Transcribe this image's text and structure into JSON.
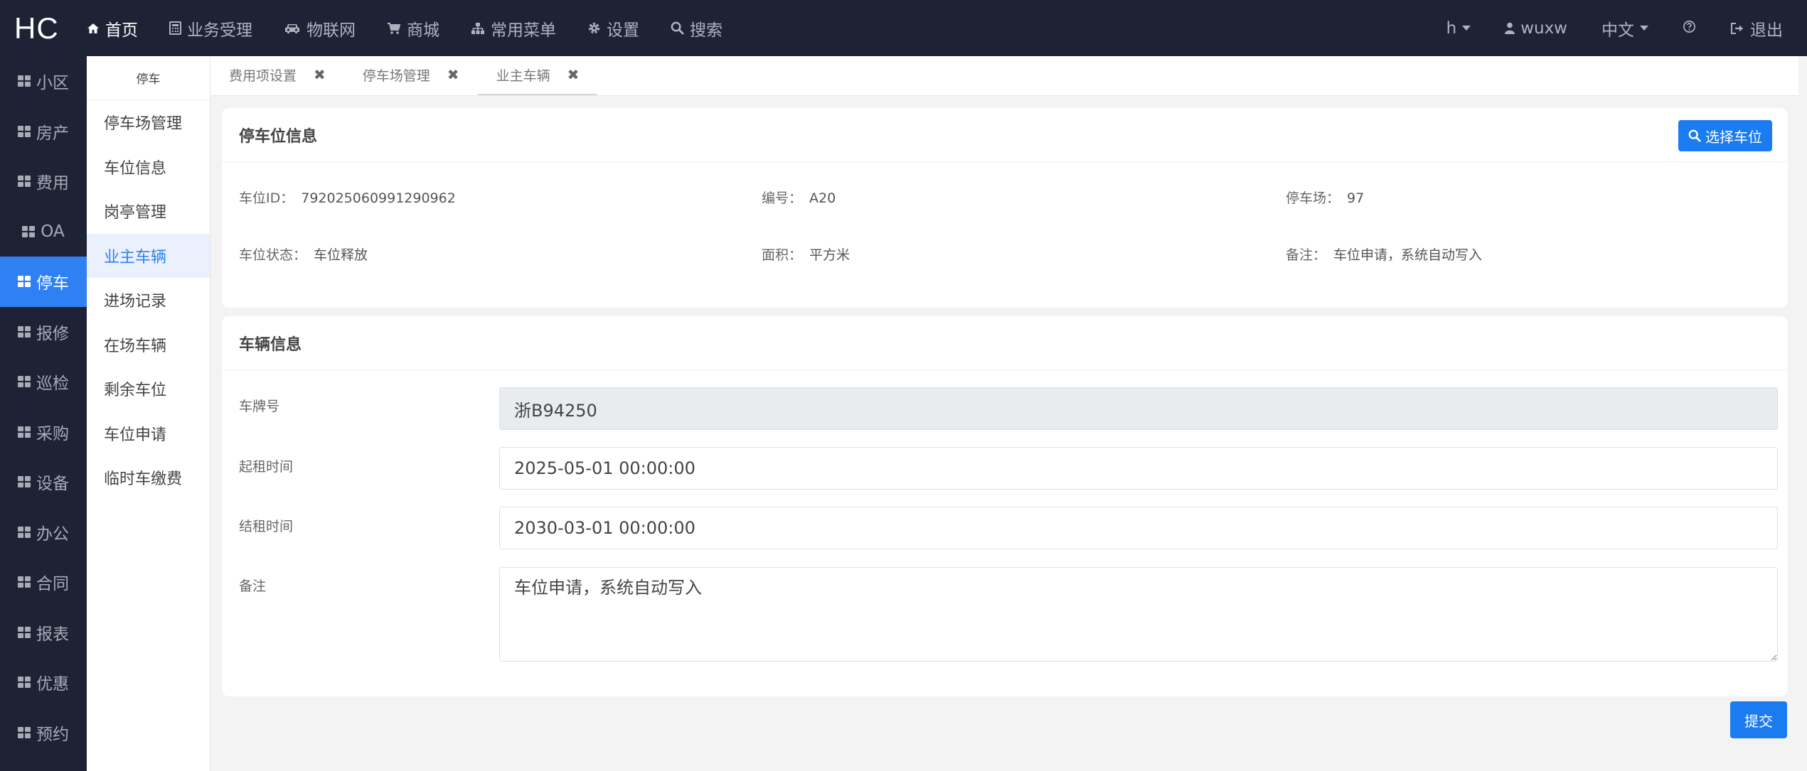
{
  "topbar": {
    "logo": "HC",
    "nav": [
      {
        "label": "首页",
        "icon": "home-icon"
      },
      {
        "label": "业务受理",
        "icon": "calculator-icon"
      },
      {
        "label": "物联网",
        "icon": "car-icon"
      },
      {
        "label": "商城",
        "icon": "cart-icon"
      },
      {
        "label": "常用菜单",
        "icon": "sitemap-icon"
      },
      {
        "label": "设置",
        "icon": "gear-icon"
      },
      {
        "label": "搜索",
        "icon": "search-icon"
      }
    ],
    "right": {
      "community": "h",
      "user": "wuxw",
      "language": "中文",
      "logout": "退出"
    }
  },
  "sidebar": {
    "items": [
      "小区",
      "房产",
      "费用",
      "OA",
      "停车",
      "报修",
      "巡检",
      "采购",
      "设备",
      "办公",
      "合同",
      "报表",
      "优惠",
      "预约"
    ],
    "active": "停车"
  },
  "submenu": {
    "title": "停车",
    "items": [
      "停车场管理",
      "车位信息",
      "岗亭管理",
      "业主车辆",
      "进场记录",
      "在场车辆",
      "剩余车位",
      "车位申请",
      "临时车缴费"
    ],
    "active": "业主车辆"
  },
  "tabs": [
    {
      "label": "费用项设置"
    },
    {
      "label": "停车场管理"
    },
    {
      "label": "业主车辆"
    }
  ],
  "parking_info": {
    "title": "停车位信息",
    "select_button": "选择车位",
    "space_id_label": "车位ID：",
    "space_id": "792025060991290962",
    "number_label": "编号：",
    "number": "A20",
    "lot_label": "停车场：",
    "lot": "97",
    "status_label": "车位状态：",
    "status": "车位释放",
    "area_label": "面积：",
    "area": "平方米",
    "remark_label": "备注：",
    "remark": "车位申请，系统自动写入"
  },
  "vehicle_info": {
    "title": "车辆信息",
    "plate_label": "车牌号",
    "plate_value": "浙B94250",
    "start_label": "起租时间",
    "start_value": "2025-05-01 00:00:00",
    "end_label": "结租时间",
    "end_value": "2030-03-01 00:00:00",
    "remark_label": "备注",
    "remark_value": "车位申请，系统自动写入"
  },
  "submit_button": "提交",
  "colors": {
    "navbar": "#1e2235",
    "accent": "#2e80f3",
    "button": "#1a7cf0",
    "page_bg": "#f3f3f4"
  }
}
